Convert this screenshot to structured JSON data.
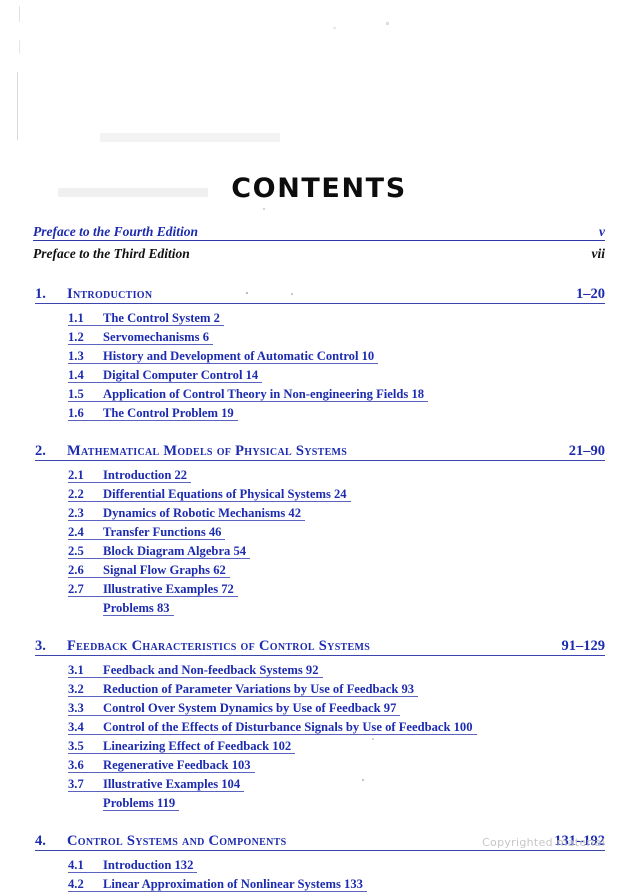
{
  "page": {
    "title": "CONTENTS",
    "watermark": "Copyrighted material",
    "link_color": "#1c2bb0",
    "text_color": "#111111",
    "background": "#ffffff"
  },
  "front_matter": [
    {
      "title": "Preface to the Fourth Edition",
      "page": "v",
      "linked": true
    },
    {
      "title": "Preface to the Third Edition",
      "page": "vii",
      "linked": false
    }
  ],
  "chapters": [
    {
      "number": "1.",
      "title": "Introduction",
      "pages": "1–20",
      "sections": [
        {
          "num": "1.1",
          "text": "The Control System   2"
        },
        {
          "num": "1.2",
          "text": "Servomechanisms   6"
        },
        {
          "num": "1.3",
          "text": "History and Development of Automatic Control   10"
        },
        {
          "num": "1.4",
          "text": "Digital Computer Control   14"
        },
        {
          "num": "1.5",
          "text": "Application of Control Theory in Non-engineering Fields   18"
        },
        {
          "num": "1.6",
          "text": "The Control Problem   19"
        }
      ]
    },
    {
      "number": "2.",
      "title": "Mathematical Models of Physical Systems",
      "pages": "21–90",
      "sections": [
        {
          "num": "2.1",
          "text": "Introduction   22"
        },
        {
          "num": "2.2",
          "text": "Differential Equations of Physical Systems   24"
        },
        {
          "num": "2.3",
          "text": "Dynamics of Robotic Mechanisms   42"
        },
        {
          "num": "2.4",
          "text": "Transfer Functions   46"
        },
        {
          "num": "2.5",
          "text": "Block Diagram Algebra   54"
        },
        {
          "num": "2.6",
          "text": "Signal Flow Graphs   62"
        },
        {
          "num": "2.7",
          "text": "Illustrative Examples   72"
        },
        {
          "num": "",
          "text": "Problems   83"
        }
      ]
    },
    {
      "number": "3.",
      "title": "Feedback Characteristics of Control Systems",
      "pages": "91–129",
      "sections": [
        {
          "num": "3.1",
          "text": "Feedback and Non-feedback Systems   92"
        },
        {
          "num": "3.2",
          "text": "Reduction of Parameter Variations by Use of Feedback   93"
        },
        {
          "num": "3.3",
          "text": "Control Over System Dynamics by Use of Feedback   97"
        },
        {
          "num": "3.4",
          "text": "Control of the Effects of Disturbance Signals by Use of Feedback   100"
        },
        {
          "num": "3.5",
          "text": "Linearizing Effect of Feedback   102"
        },
        {
          "num": "3.6",
          "text": "Regenerative Feedback   103"
        },
        {
          "num": "3.7",
          "text": "Illustrative Examples   104"
        },
        {
          "num": "",
          "text": "Problems   119"
        }
      ]
    },
    {
      "number": "4.",
      "title": "Control Systems and Components",
      "pages": "131–192",
      "sections": [
        {
          "num": "4.1",
          "text": "Introduction   132"
        },
        {
          "num": "4.2",
          "text": "Linear Approximation of Nonlinear Systems   133"
        }
      ]
    }
  ]
}
